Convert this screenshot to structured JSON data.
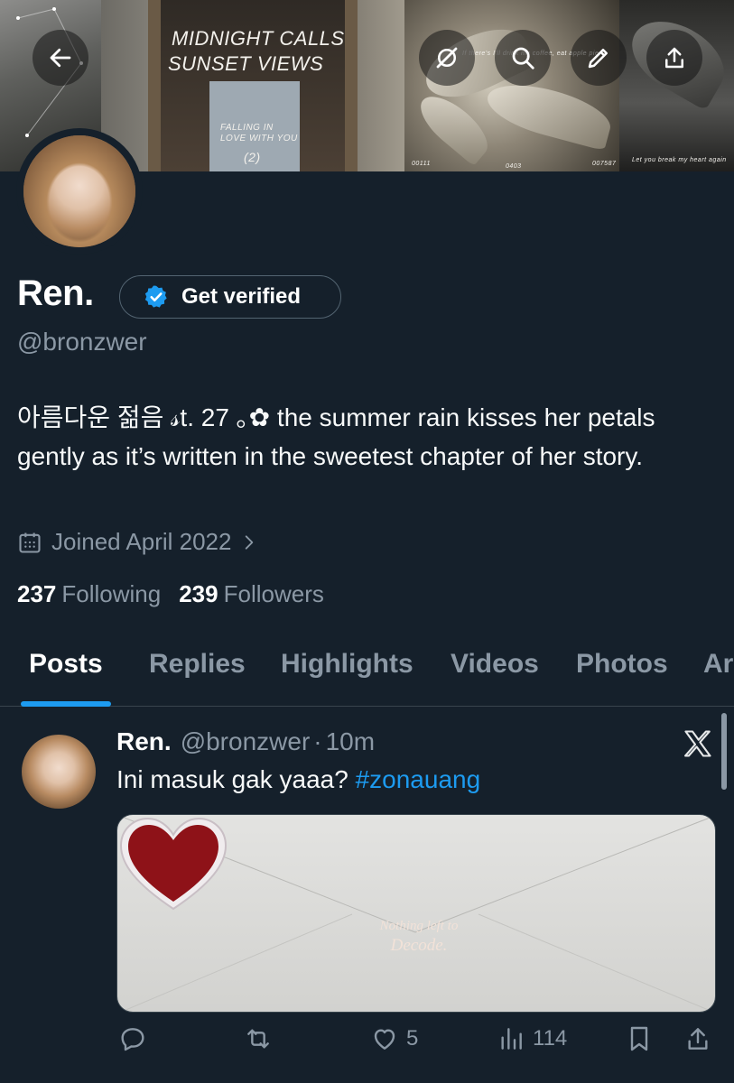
{
  "banner": {
    "texts": {
      "midnight_calls": "MIDNIGHT CALLS",
      "sunset_views": "SUNSET   VIEWS",
      "falling": "FALLING IN LOVE WITH YOU",
      "two": "(2)",
      "num1": "00111",
      "num2": "0403",
      "num3": "007587",
      "heart": "Let you break my heart again",
      "pearl": "If there's I'll drink my coffee, eat apple pie"
    }
  },
  "header": {
    "back_icon": "arrow-left-icon",
    "actions": [
      "grok-icon",
      "search-icon",
      "edit-icon",
      "share-icon"
    ]
  },
  "profile": {
    "name": "Ren.",
    "verify_label": "Get verified",
    "handle": "@bronzwer",
    "bio": "아름다운 젊음 𝓈t. 27 ｡✿ the summer rain kisses her petals gently as it’s written in the sweetest chapter of her story.",
    "joined": "Joined April 2022",
    "following_count": "237",
    "following_label": "Following",
    "followers_count": "239",
    "followers_label": "Followers"
  },
  "tabs": [
    "Posts",
    "Replies",
    "Highlights",
    "Videos",
    "Photos",
    "Ar"
  ],
  "active_tab": "Posts",
  "post": {
    "name": "Ren.",
    "handle": "@bronzwer",
    "separator": "·",
    "time": "10m",
    "text": "Ini masuk gak yaaa?",
    "hashtag": "#zonauang",
    "media_text_line1": "Nothing left to",
    "media_text_line2": "Decode.",
    "actions": {
      "reply": "",
      "repost": "",
      "like": "5",
      "views": "114"
    }
  },
  "colors": {
    "background": "#15202b",
    "accent": "#1d9bf0",
    "muted": "#8b98a5",
    "border": "#38444d"
  }
}
